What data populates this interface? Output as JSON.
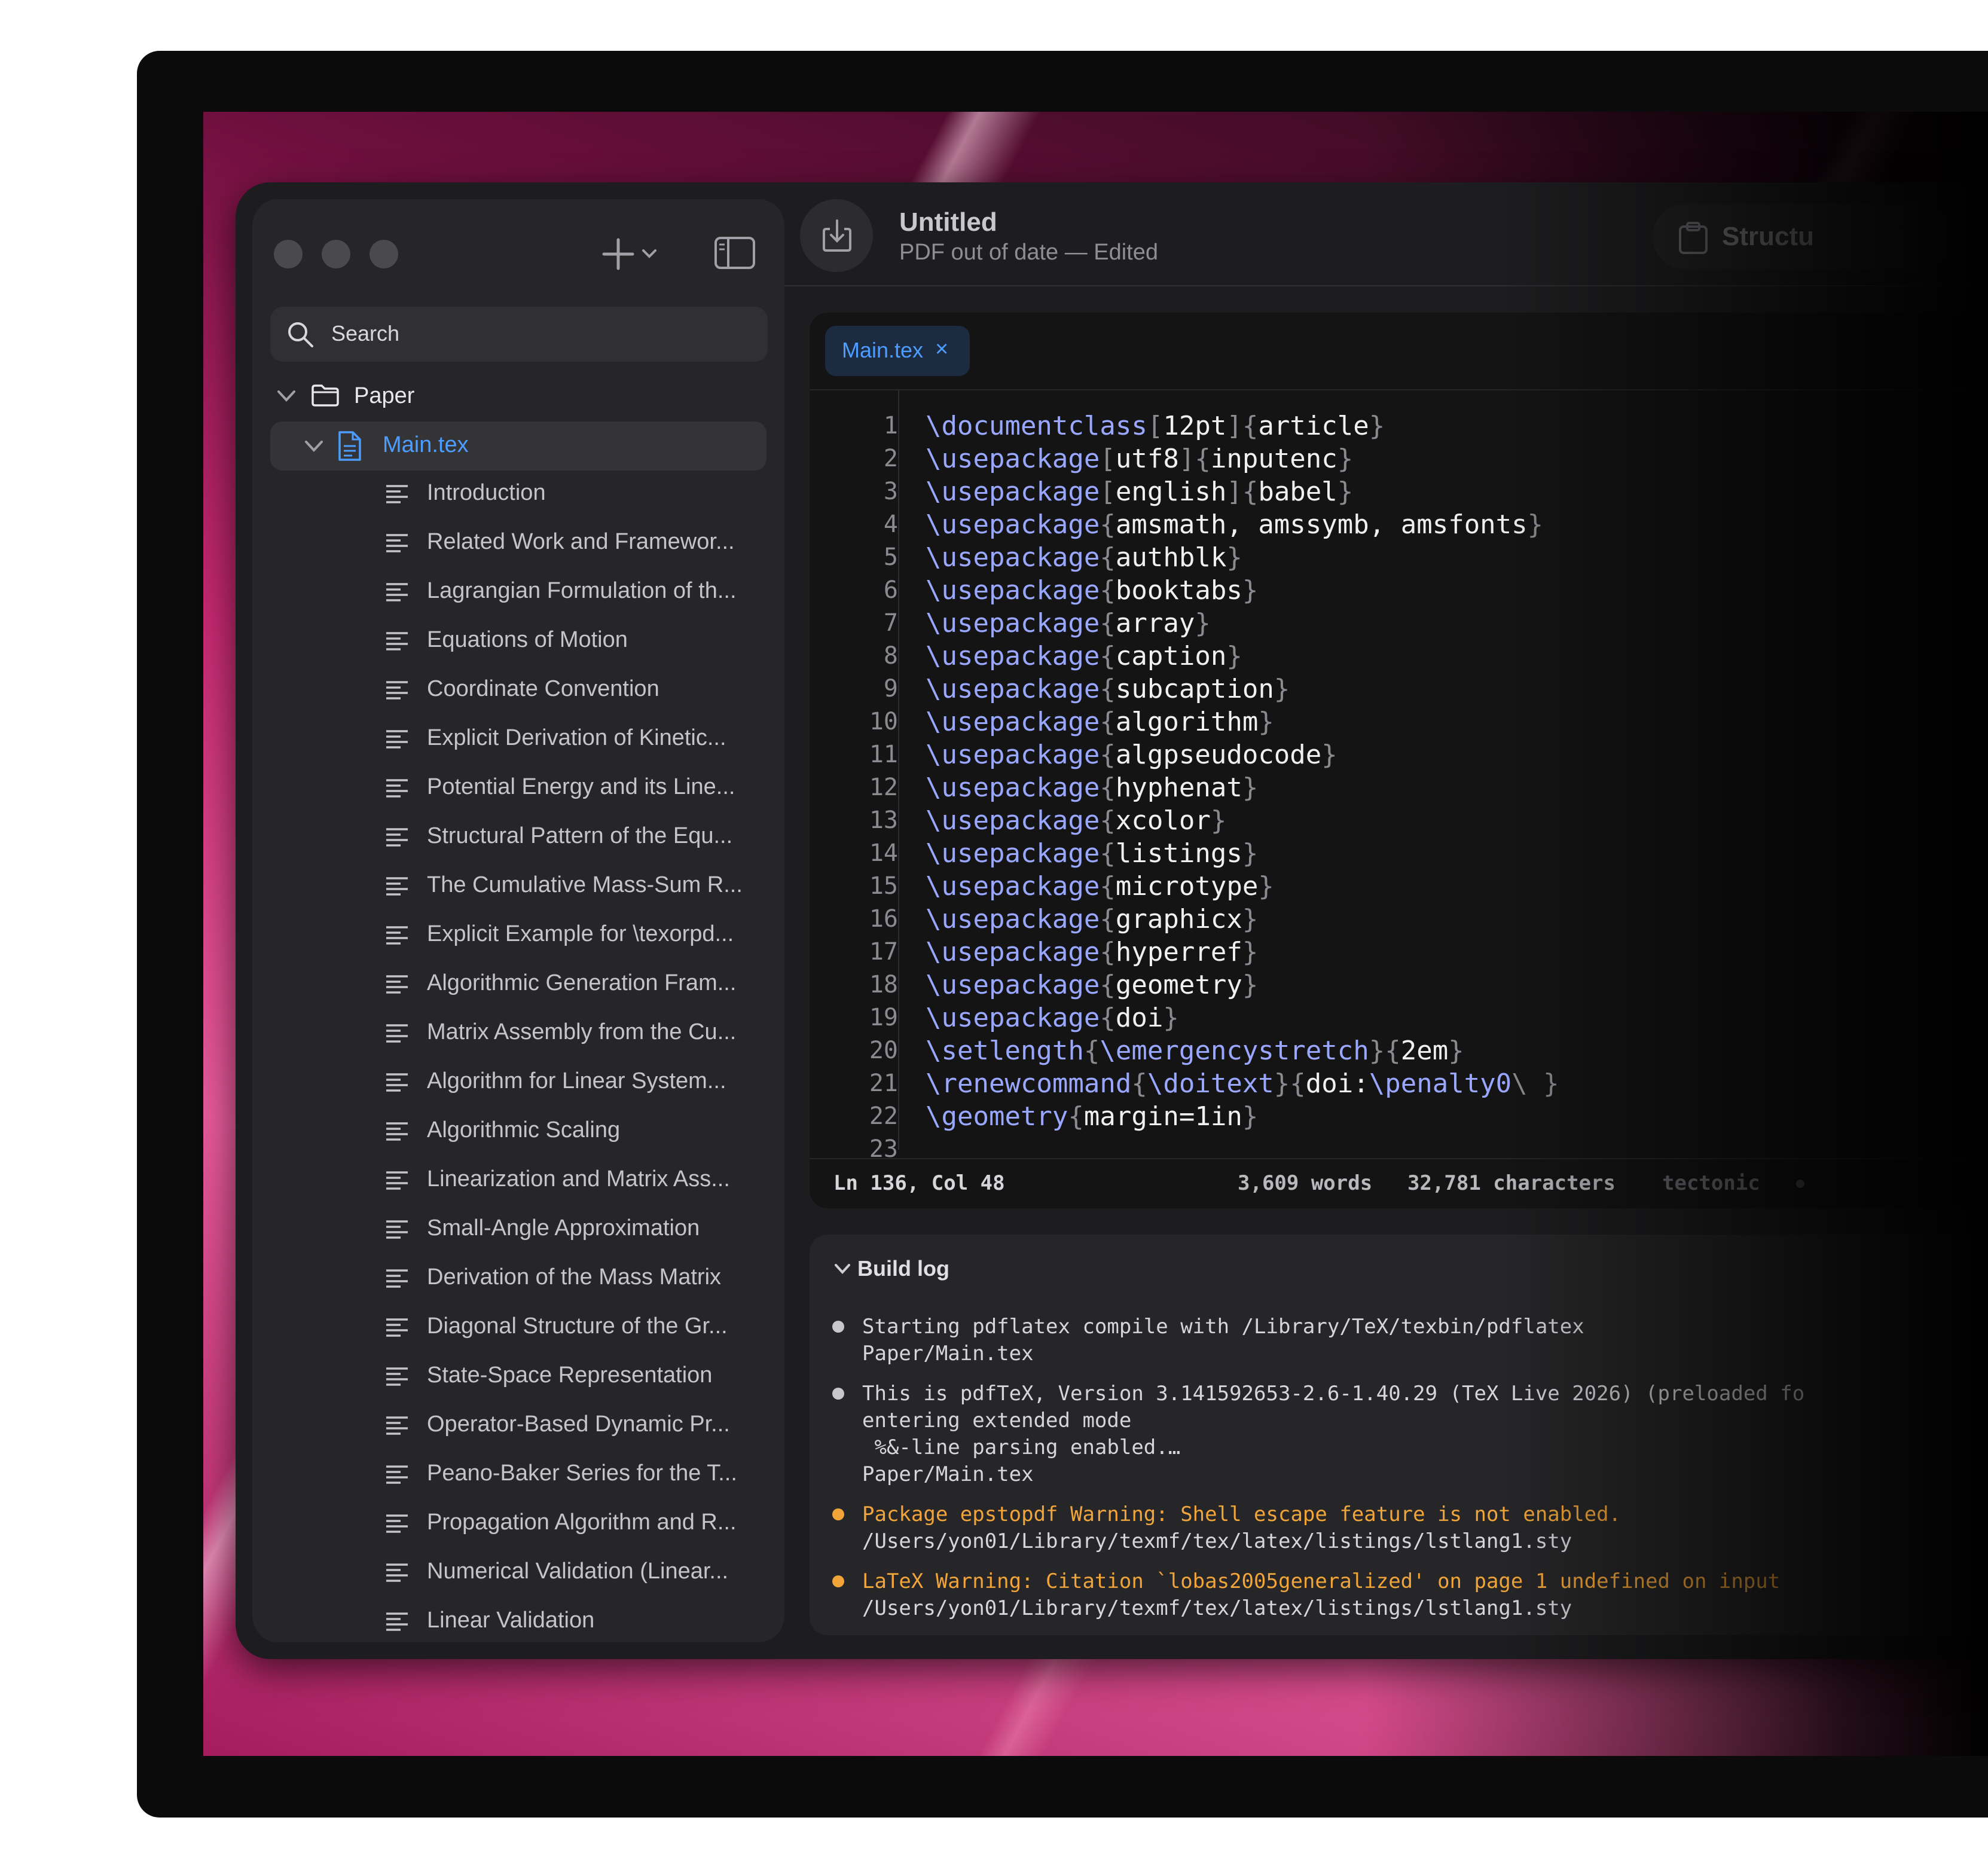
{
  "sidebar": {
    "search_placeholder": "Search",
    "folder": "Paper",
    "file": "Main.tex",
    "outline": [
      "Introduction",
      "Related Work and Framewor...",
      "Lagrangian Formulation of th...",
      "Equations of Motion",
      "Coordinate Convention",
      "Explicit Derivation of Kinetic...",
      "Potential Energy and its Line...",
      "Structural Pattern of the Equ...",
      "The Cumulative Mass-Sum R...",
      "Explicit Example for \\texorpd...",
      "Algorithmic Generation Fram...",
      "Matrix Assembly from the Cu...",
      "Algorithm for Linear System...",
      "Algorithmic Scaling",
      "Linearization and Matrix Ass...",
      "Small-Angle Approximation",
      "Derivation of the Mass Matrix",
      "Diagonal Structure of the Gr...",
      "State-Space Representation",
      "Operator-Based Dynamic Pr...",
      "Peano-Baker Series for the T...",
      "Propagation Algorithm and R...",
      "Numerical Validation (Linear...",
      "Linear Validation"
    ]
  },
  "toolbar": {
    "title": "Untitled",
    "subtitle": "PDF out of date — Edited",
    "structure_label": "Structu"
  },
  "editor": {
    "tab_label": "Main.tex",
    "tab_close": "×",
    "lines": [
      [
        [
          "kw",
          "\\documentclass"
        ],
        [
          "br",
          "["
        ],
        [
          "ar",
          "12pt"
        ],
        [
          "br",
          "]{"
        ],
        [
          "ar",
          "article"
        ],
        [
          "br",
          "}"
        ]
      ],
      [
        [
          "kw",
          "\\usepackage"
        ],
        [
          "br",
          "["
        ],
        [
          "ar",
          "utf8"
        ],
        [
          "br",
          "]{"
        ],
        [
          "ar",
          "inputenc"
        ],
        [
          "br",
          "}"
        ]
      ],
      [
        [
          "kw",
          "\\usepackage"
        ],
        [
          "br",
          "["
        ],
        [
          "ar",
          "english"
        ],
        [
          "br",
          "]{"
        ],
        [
          "ar",
          "babel"
        ],
        [
          "br",
          "}"
        ]
      ],
      [
        [
          "kw",
          "\\usepackage"
        ],
        [
          "br",
          "{"
        ],
        [
          "ar",
          "amsmath, amssymb, amsfonts"
        ],
        [
          "br",
          "}"
        ]
      ],
      [
        [
          "kw",
          "\\usepackage"
        ],
        [
          "br",
          "{"
        ],
        [
          "ar",
          "authblk"
        ],
        [
          "br",
          "}"
        ]
      ],
      [
        [
          "kw",
          "\\usepackage"
        ],
        [
          "br",
          "{"
        ],
        [
          "ar",
          "booktabs"
        ],
        [
          "br",
          "}"
        ]
      ],
      [
        [
          "kw",
          "\\usepackage"
        ],
        [
          "br",
          "{"
        ],
        [
          "ar",
          "array"
        ],
        [
          "br",
          "}"
        ]
      ],
      [
        [
          "kw",
          "\\usepackage"
        ],
        [
          "br",
          "{"
        ],
        [
          "ar",
          "caption"
        ],
        [
          "br",
          "}"
        ]
      ],
      [
        [
          "kw",
          "\\usepackage"
        ],
        [
          "br",
          "{"
        ],
        [
          "ar",
          "subcaption"
        ],
        [
          "br",
          "}"
        ]
      ],
      [
        [
          "kw",
          "\\usepackage"
        ],
        [
          "br",
          "{"
        ],
        [
          "ar",
          "algorithm"
        ],
        [
          "br",
          "}"
        ]
      ],
      [
        [
          "kw",
          "\\usepackage"
        ],
        [
          "br",
          "{"
        ],
        [
          "ar",
          "algpseudocode"
        ],
        [
          "br",
          "}"
        ]
      ],
      [
        [
          "kw",
          "\\usepackage"
        ],
        [
          "br",
          "{"
        ],
        [
          "ar",
          "hyphenat"
        ],
        [
          "br",
          "}"
        ]
      ],
      [
        [
          "kw",
          "\\usepackage"
        ],
        [
          "br",
          "{"
        ],
        [
          "ar",
          "xcolor"
        ],
        [
          "br",
          "}"
        ]
      ],
      [
        [
          "kw",
          "\\usepackage"
        ],
        [
          "br",
          "{"
        ],
        [
          "ar",
          "listings"
        ],
        [
          "br",
          "}"
        ]
      ],
      [
        [
          "kw",
          "\\usepackage"
        ],
        [
          "br",
          "{"
        ],
        [
          "ar",
          "microtype"
        ],
        [
          "br",
          "}"
        ]
      ],
      [
        [
          "kw",
          "\\usepackage"
        ],
        [
          "br",
          "{"
        ],
        [
          "ar",
          "graphicx"
        ],
        [
          "br",
          "}"
        ]
      ],
      [
        [
          "kw",
          "\\usepackage"
        ],
        [
          "br",
          "{"
        ],
        [
          "ar",
          "hyperref"
        ],
        [
          "br",
          "}"
        ]
      ],
      [
        [
          "kw",
          "\\usepackage"
        ],
        [
          "br",
          "{"
        ],
        [
          "ar",
          "geometry"
        ],
        [
          "br",
          "}"
        ]
      ],
      [
        [
          "kw",
          "\\usepackage"
        ],
        [
          "br",
          "{"
        ],
        [
          "ar",
          "doi"
        ],
        [
          "br",
          "}"
        ]
      ],
      [
        [
          "kw",
          "\\setlength"
        ],
        [
          "br",
          "{"
        ],
        [
          "kw",
          "\\emergencystretch"
        ],
        [
          "br",
          "}{"
        ],
        [
          "ar",
          "2em"
        ],
        [
          "br",
          "}"
        ]
      ],
      [
        [
          "kw",
          "\\renewcommand"
        ],
        [
          "br",
          "{"
        ],
        [
          "kw",
          "\\doitext"
        ],
        [
          "br",
          "}{"
        ],
        [
          "ar",
          "doi:"
        ],
        [
          "kw",
          "\\penalty0"
        ],
        [
          "br",
          "\\ }"
        ]
      ],
      [
        [
          "kw",
          "\\geometry"
        ],
        [
          "br",
          "{"
        ],
        [
          "ar",
          "margin=1in"
        ],
        [
          "br",
          "}"
        ]
      ],
      []
    ],
    "status": {
      "position": "Ln 136, Col 48",
      "words": "3,609 words",
      "characters": "32,781 characters",
      "engine": "tectonic"
    }
  },
  "build_log": {
    "title": "Build log",
    "entries": [
      {
        "level": "info",
        "lines": [
          "Starting pdflatex compile with /Library/TeX/texbin/pdflatex",
          "Paper/Main.tex"
        ]
      },
      {
        "level": "info",
        "lines": [
          "This is pdfTeX, Version 3.141592653-2.6-1.40.29 (TeX Live 2026) (preloaded fo",
          "entering extended mode",
          " %&-line parsing enabled.…",
          "Paper/Main.tex"
        ]
      },
      {
        "level": "warning",
        "lines": [
          "Package epstopdf Warning: Shell escape feature is not enabled.",
          "/Users/yon01/Library/texmf/tex/latex/listings/lstlang1.sty"
        ]
      },
      {
        "level": "warning",
        "lines": [
          "LaTeX Warning: Citation `lobas2005generalized' on page 1 undefined on input",
          "/Users/yon01/Library/texmf/tex/latex/listings/lstlang1.sty"
        ]
      }
    ]
  },
  "colors": {
    "accent": "#4c9dff",
    "keyword": "#9aa7ff",
    "warning": "#f0a43a",
    "info_dot": "#c8c8cc"
  }
}
